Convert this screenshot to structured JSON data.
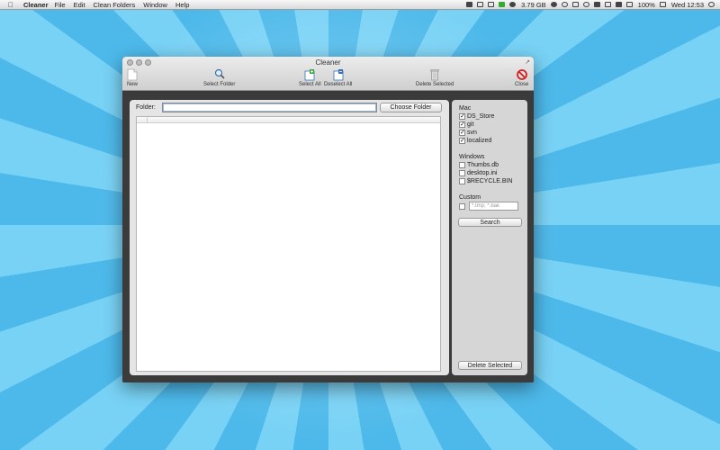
{
  "menubar": {
    "app": "Cleaner",
    "items": [
      "File",
      "Edit",
      "Clean Folders",
      "Window",
      "Help"
    ],
    "status": {
      "memory": "3.79 GB",
      "battery": "100%",
      "clock": "Wed 12:53"
    }
  },
  "window": {
    "title": "Cleaner",
    "toolbar": {
      "new": "New",
      "select_folder": "Select Folder",
      "select_all": "Select All",
      "deselect_all": "Deselect All",
      "delete_selected": "Delete Selected",
      "close": "Close"
    }
  },
  "main": {
    "folder_label": "Folder:",
    "folder_value": "",
    "choose_folder": "Choose Folder"
  },
  "sidebar": {
    "mac": {
      "title": "Mac",
      "items": [
        {
          "label": "DS_Store",
          "checked": true
        },
        {
          "label": "git",
          "checked": true
        },
        {
          "label": "svn",
          "checked": true
        },
        {
          "label": "localized",
          "checked": true
        }
      ]
    },
    "windows": {
      "title": "Windows",
      "items": [
        {
          "label": "Thumbs.db",
          "checked": false
        },
        {
          "label": "desktop.ini",
          "checked": false
        },
        {
          "label": "$RECYCLE.BIN",
          "checked": false
        }
      ]
    },
    "custom": {
      "title": "Custom",
      "checked": false,
      "placeholder": "*.tmp; *.bak"
    },
    "search": "Search",
    "delete_selected": "Delete Selected"
  },
  "colors": {
    "desktop_light": "#78d2f5",
    "desktop_dark": "#4db9ea",
    "window_frame": "#3b3b3b",
    "close_red": "#d61f1f"
  }
}
